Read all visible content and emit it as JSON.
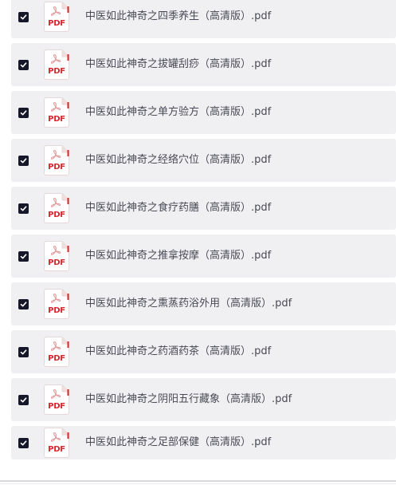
{
  "colors": {
    "row_background": "#f0f0f3",
    "checkbox_fill": "#17172a",
    "pdf_red": "#d9262b",
    "text": "#4a4a55"
  },
  "files": [
    {
      "name": "中医如此神奇之四季养生（高清版）.pdf",
      "checked": true,
      "icon": "pdf-icon",
      "icon_label": "PDF"
    },
    {
      "name": "中医如此神奇之拔罐刮痧（高清版）.pdf",
      "checked": true,
      "icon": "pdf-icon",
      "icon_label": "PDF"
    },
    {
      "name": "中医如此神奇之单方验方（高清版）.pdf",
      "checked": true,
      "icon": "pdf-icon",
      "icon_label": "PDF"
    },
    {
      "name": "中医如此神奇之经络穴位（高清版）.pdf",
      "checked": true,
      "icon": "pdf-icon",
      "icon_label": "PDF"
    },
    {
      "name": "中医如此神奇之食疗药膳（高清版）.pdf",
      "checked": true,
      "icon": "pdf-icon",
      "icon_label": "PDF"
    },
    {
      "name": "中医如此神奇之推拿按摩（高清版）.pdf",
      "checked": true,
      "icon": "pdf-icon",
      "icon_label": "PDF"
    },
    {
      "name": "中医如此神奇之熏蒸药浴外用（高清版）.pdf",
      "checked": true,
      "icon": "pdf-icon",
      "icon_label": "PDF"
    },
    {
      "name": "中医如此神奇之药酒药茶（高清版）.pdf",
      "checked": true,
      "icon": "pdf-icon",
      "icon_label": "PDF"
    },
    {
      "name": "中医如此神奇之阴阳五行藏象（高清版）.pdf",
      "checked": true,
      "icon": "pdf-icon",
      "icon_label": "PDF"
    },
    {
      "name": "中医如此神奇之足部保健（高清版）.pdf",
      "checked": true,
      "icon": "pdf-icon",
      "icon_label": "PDF"
    }
  ]
}
